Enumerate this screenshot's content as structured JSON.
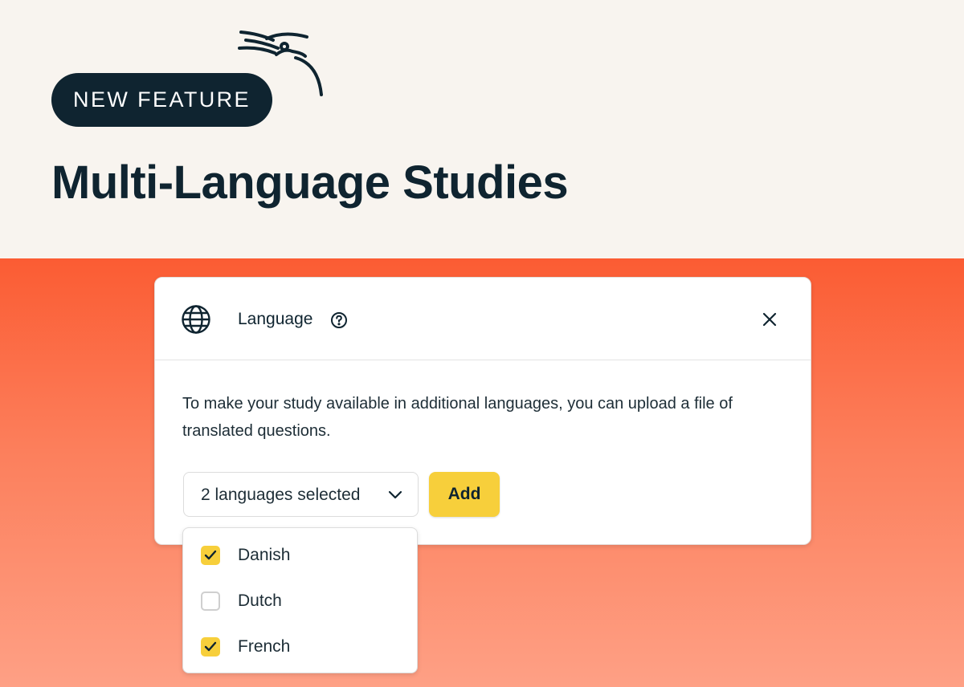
{
  "hero": {
    "badge": "NEW FEATURE",
    "headline": "Multi-Language Studies"
  },
  "dialog": {
    "title": "Language",
    "description": "To make your study available in additional languages, you can upload a file of translated questions.",
    "select_label": "2 languages selected",
    "add_label": "Add",
    "icons": {
      "header": "globe-icon",
      "help": "help-circle-icon",
      "close": "close-icon",
      "select": "chevron-down-icon"
    }
  },
  "dropdown": {
    "options": [
      {
        "label": "Danish",
        "checked": true
      },
      {
        "label": "Dutch",
        "checked": false
      },
      {
        "label": "French",
        "checked": true
      }
    ]
  },
  "colors": {
    "navy": "#0f2430",
    "accent_yellow": "#f7cf3b",
    "cream": "#f8f4ef",
    "orange_top": "#fb5c33",
    "orange_bottom": "#fea085"
  }
}
